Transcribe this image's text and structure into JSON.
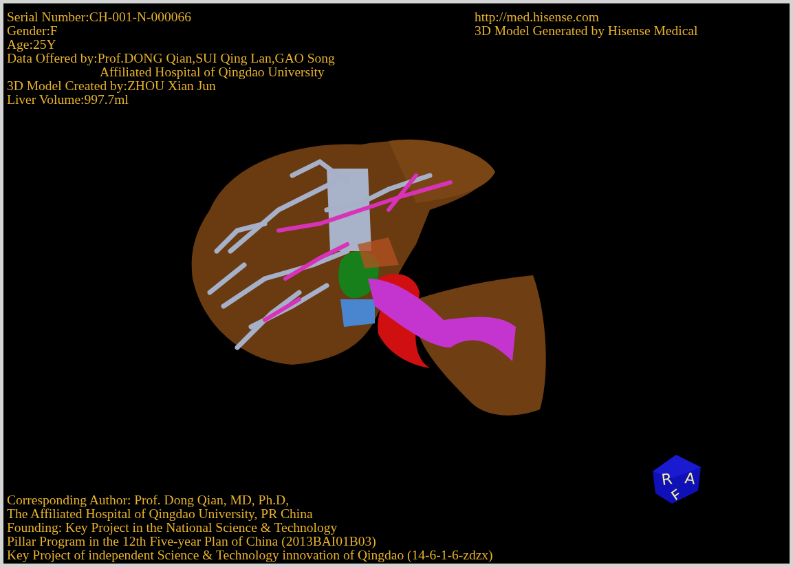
{
  "viewer": {
    "info_top_left": [
      {
        "kind": "line",
        "text": "Serial Number:CH-001-N-000066"
      },
      {
        "kind": "line",
        "text": "Gender:F"
      },
      {
        "kind": "line",
        "text": "Age:25Y"
      },
      {
        "kind": "line",
        "text": "Data Offered by:Prof.DONG Qian,SUI Qing Lan,GAO Song"
      },
      {
        "kind": "continuation",
        "text": "Affiliated Hospital of Qingdao University"
      },
      {
        "kind": "line",
        "text": "3D Model Created by:ZHOU Xian Jun"
      },
      {
        "kind": "line",
        "text": "Liver Volume:997.7ml"
      }
    ],
    "info_top_right": [
      "http://med.hisense.com",
      "3D Model Generated by Hisense Medical"
    ],
    "info_bottom_left": [
      "Corresponding Author: Prof. Dong Qian, MD, Ph.D,",
      "The Affiliated Hospital of Qingdao University, PR China",
      "Founding: Key Project in the National Science & Technology",
      "Pillar Program in the 12th Five-year Plan of China (2013BAI01B03)",
      "Key Project of independent Science & Technology innovation of Qingdao (14-6-1-6-zdzx)"
    ],
    "orientation_cube": {
      "faces": [
        "R",
        "A",
        "F"
      ]
    }
  }
}
